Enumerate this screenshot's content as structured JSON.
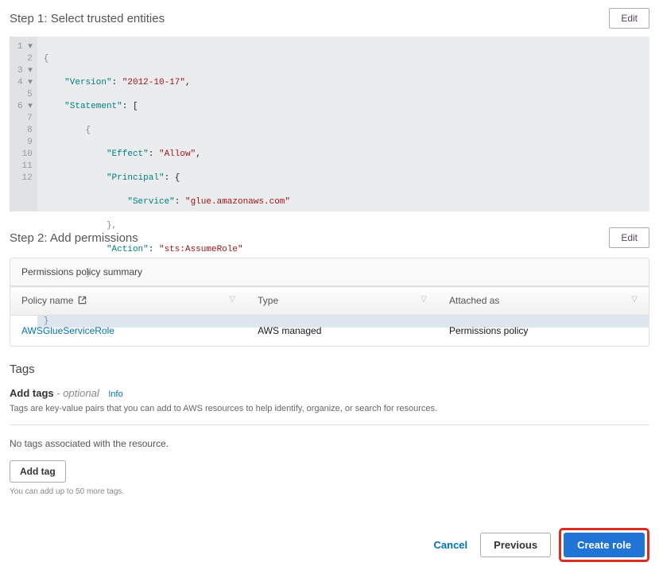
{
  "step1": {
    "title": "Step 1: Select trusted entities",
    "edit_label": "Edit",
    "code": {
      "line1_brace": "{",
      "line2_key": "\"Version\"",
      "line2_sep": ": ",
      "line2_val": "\"2012-10-17\"",
      "line2_comma": ",",
      "line3_key": "\"Statement\"",
      "line3_sep": ": [",
      "line4": "{",
      "line5_key": "\"Effect\"",
      "line5_sep": ": ",
      "line5_val": "\"Allow\"",
      "line5_comma": ",",
      "line6_key": "\"Principal\"",
      "line6_sep": ": {",
      "line7_key": "\"Service\"",
      "line7_sep": ": ",
      "line7_val": "\"glue.amazonaws.com\"",
      "line8": "},",
      "line9_key": "\"Action\"",
      "line9_sep": ": ",
      "line9_val": "\"sts:AssumeRole\"",
      "line10": "}",
      "line11": "]",
      "line12": "}"
    }
  },
  "step2": {
    "title": "Step 2: Add permissions",
    "edit_label": "Edit",
    "summary_label": "Permissions policy summary",
    "columns": {
      "name": "Policy name",
      "type": "Type",
      "attached": "Attached as"
    },
    "row": {
      "name": "AWSGlueServiceRole",
      "type": "AWS managed",
      "attached": "Permissions policy"
    }
  },
  "tags": {
    "section_title": "Tags",
    "add_label": "Add tags",
    "optional": "- optional",
    "info": "Info",
    "hint": "Tags are key-value pairs that you can add to AWS resources to help identify, organize, or search for resources.",
    "no_tags": "No tags associated with the resource.",
    "add_tag_btn": "Add tag",
    "limit": "You can add up to 50 more tags."
  },
  "footer": {
    "cancel": "Cancel",
    "previous": "Previous",
    "create": "Create role"
  }
}
